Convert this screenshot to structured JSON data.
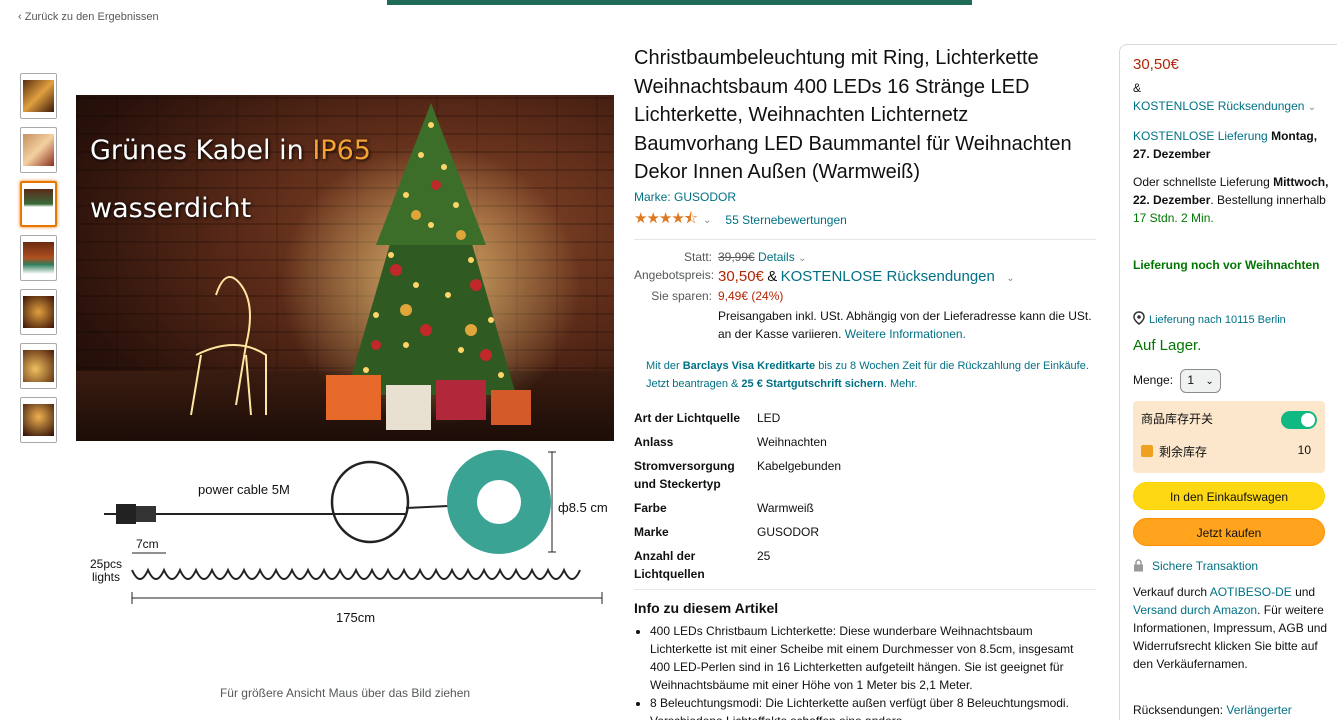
{
  "nav": {
    "back_link": "‹ Zurück zu den Ergebnissen"
  },
  "gallery": {
    "headline_part1": "Grünes Kabel in ",
    "headline_accent": "IP65",
    "headline_line2": "wasserdicht",
    "diagram_power_cable": "power cable 5M",
    "diagram_diameter": "ф8.5 cm",
    "diagram_spacing": "7cm",
    "diagram_count_line1": "25pcs",
    "diagram_count_line2": "lights",
    "diagram_length": "175cm",
    "caption": "Für größere Ansicht Maus über das Bild ziehen"
  },
  "product": {
    "title": "Christbaumbeleuchtung mit Ring, Lichterkette Weihnachtsbaum 400 LEDs 16 Stränge LED Lichterkette, Weihnachten Lichternetz Baumvorhang LED Baummantel für Weihnachten Dekor Innen Außen (Warmweiß)",
    "brand_link": "Marke: GUSODOR",
    "rating_stars": "★★★★⯪",
    "rating_count": "55 Sternebewertungen"
  },
  "pricing": {
    "was_label": "Statt:",
    "was_price": "39,99€",
    "details_link": "Details",
    "offer_label": "Angebotspreis:",
    "offer_price": "30,50€",
    "amp": "&",
    "free_returns": "KOSTENLOSE Rücksendungen",
    "save_label": "Sie sparen:",
    "save_value": "9,49€ (24%)",
    "tax_note": "Preisangaben inkl. USt. Abhängig von der Lieferadresse kann die USt. an der Kasse variieren.",
    "more_info_link": "Weitere Informationen."
  },
  "barclays": {
    "prefix": "Mit der ",
    "card": "Barclays Visa Kreditkarte",
    "middle": " bis zu 8 Wochen Zeit für die Rückzahlung der Einkäufe. Jetzt beantragen & ",
    "bonus": "25 € Startgutschrift sichern",
    "suffix": ". Mehr."
  },
  "specs": [
    {
      "key": "Art der Lichtquelle",
      "value": "LED"
    },
    {
      "key": "Anlass",
      "value": "Weihnachten"
    },
    {
      "key": "Stromversorgung und Steckertyp",
      "value": "Kabelgebunden"
    },
    {
      "key": "Farbe",
      "value": "Warmweiß"
    },
    {
      "key": "Marke",
      "value": "GUSODOR"
    },
    {
      "key": "Anzahl der Lichtquellen",
      "value": "25"
    }
  ],
  "about": {
    "title": "Info zu diesem Artikel",
    "bullets": [
      "400 LEDs Christbaum Lichterkette: Diese wunderbare Weihnachtsbaum Lichterkette ist mit einer Scheibe mit einem Durchmesser von 8.5cm, insgesamt 400 LED-Perlen sind in 16 Lichterketten aufgeteilt hängen. Sie ist geeignet für Weihnachtsbäume mit einer Höhe von 1 Meter bis 2,1 Meter.",
      "8 Beleuchtungsmodi: Die Lichterkette außen verfügt über 8 Beleuchtungsmodi. Verschiedene Lichteffekte schaffen eine andere"
    ]
  },
  "buybox": {
    "price": "30,50€",
    "amp": "&",
    "free_returns": "KOSTENLOSE Rücksendungen",
    "free_delivery": "KOSTENLOSE Lieferung",
    "delivery_date": "Montag, 27. Dezember",
    "fast_prefix": "Oder schnellste Lieferung ",
    "fast_date": "Mittwoch, 22. Dezember",
    "order_within_prefix": ". Bestellung innerhalb ",
    "order_within": "17 Stdn. 2 Min.",
    "before_xmas": "Lieferung noch vor Weihnachten",
    "location": "Lieferung nach 10115 Berlin",
    "stock": "Auf Lager.",
    "qty_label": "Menge:",
    "qty_value": "1",
    "ext_toggle_label": "商品库存开关",
    "ext_stock_label": "剩余库存",
    "ext_stock_value": "10",
    "add_to_cart": "In den Einkaufswagen",
    "buy_now": "Jetzt kaufen",
    "secure": "Sichere Transaktion",
    "seller_prefix": "Verkauf durch ",
    "seller": "AOTIBESO-DE",
    "seller_and": " und ",
    "ship_by": "Versand durch Amazon",
    "seller_suffix": ". Für weitere Informationen, Impressum, AGB und Widerrufsrecht klicken Sie bitte auf den Verkäufernamen.",
    "returns_label": "Rücksendungen: ",
    "returns_link": "Verlängerter"
  },
  "colors": {
    "link": "#007185",
    "price": "#b12704",
    "cart": "#ffd814",
    "buy": "#ffa41c",
    "stock": "#007600"
  }
}
